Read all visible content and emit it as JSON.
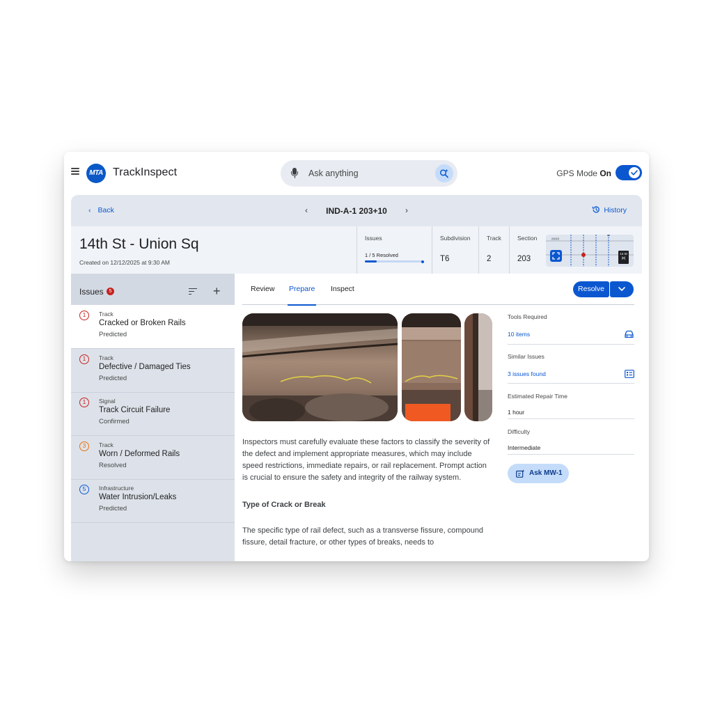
{
  "app": {
    "logo_text": "MTA",
    "brand_primary": "Track",
    "brand_secondary": "Inspect",
    "search_placeholder": "Ask anything",
    "gps_label": "GPS Mode",
    "gps_state": "On",
    "gps_enabled": true
  },
  "nav": {
    "back_label": "Back",
    "record_id": "IND-A-1 203+10",
    "history_label": "History"
  },
  "header": {
    "station": "14th St - Union Sq",
    "created": "Created on 12/12/2025 at 9:30 AM",
    "metrics": {
      "issues_label": "Issues",
      "issues_resolved_text": "1 / 5 Resolved",
      "issues_resolved_fraction": 0.2,
      "subdivision_label": "Subdivision",
      "subdivision_value": "T6",
      "track_label": "Track",
      "track_value": "2",
      "section_label": "Section",
      "section_value": "203"
    },
    "minimap": {
      "label": "####",
      "marker": "1",
      "station_badge_line1": "14 St",
      "station_badge_line2": "[B]"
    }
  },
  "issues": {
    "title": "Issues",
    "count": "5",
    "items": [
      {
        "icon": "1",
        "category": "Track",
        "name": "Cracked or Broken Rails",
        "status": "Predicted",
        "color": "#c5221f"
      },
      {
        "icon": "1",
        "category": "Track",
        "name": "Defective / Damaged Ties",
        "status": "Predicted",
        "color": "#c5221f"
      },
      {
        "icon": "1",
        "category": "Signal",
        "name": "Track Circuit Failure",
        "status": "Confirmed",
        "color": "#c5221f"
      },
      {
        "icon": "3",
        "category": "Track",
        "name": "Worn / Deformed Rails",
        "status": "Resolved",
        "color": "#e8710a"
      },
      {
        "icon": "5",
        "category": "Infrastructure",
        "name": "Water Intrusion/Leaks",
        "status": "Predicted",
        "color": "#0b57d0"
      }
    ]
  },
  "tabs": {
    "review": "Review",
    "prepare": "Prepare",
    "inspect": "Inspect",
    "resolve": "Resolve"
  },
  "article": {
    "paragraph1": "Inspectors must carefully evaluate these factors to classify the severity of the defect and implement appropriate measures, which may include speed restrictions, immediate repairs, or rail replacement. Prompt action is crucial to ensure the safety and integrity of the railway system.",
    "subheading": "Type of Crack or Break",
    "paragraph2": "The specific type of rail defect, such as a transverse fissure, compound fissure, detail fracture, or other types of breaks, needs to"
  },
  "info": {
    "tools_label": "Tools Required",
    "tools_value": "10 items",
    "similar_label": "Similar Issues",
    "similar_value": "3 issues found",
    "repair_label": "Estimated Repair Time",
    "repair_value": "1 hour",
    "difficulty_label": "Difficulty",
    "difficulty_value": "Intermediate",
    "ask_label": "Ask MW-1"
  },
  "colors": {
    "accent": "#0b57d0",
    "critical": "#c5221f",
    "warning": "#e8710a",
    "panel": "#dde2ea"
  },
  "icons": [
    "menu-icon",
    "mic-icon",
    "sparkle-search-icon",
    "check-icon",
    "chevron-left-icon",
    "chevron-right-icon",
    "history-icon",
    "sort-icon",
    "add-icon",
    "chevron-down-icon",
    "car-icon",
    "list-icon",
    "ai-assistant-icon",
    "fullscreen-icon"
  ]
}
